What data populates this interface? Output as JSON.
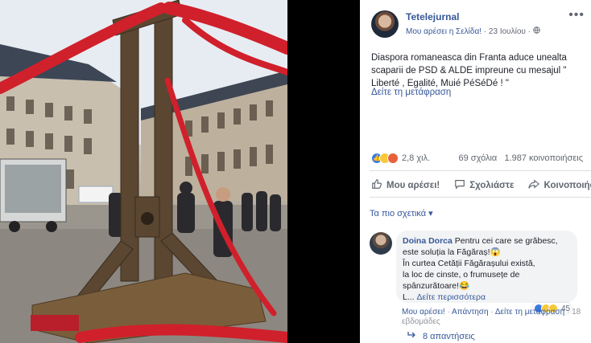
{
  "post": {
    "page_name": "Tetelejurnal",
    "like_page": "Μου αρέσει η Σελίδα!",
    "date": "23 Ιουλίου",
    "text": "Diaspora romaneasca din Franta aduce unealta scaparii de PSD & ALDE impreune cu mesajul \" Liberté , Egalité, Muié PéSéDé ! \"",
    "see_translation": "Δείτε τη μετάφραση",
    "reaction_count": "2,8 χιλ.",
    "comments_count": "69 σχόλια",
    "shares_count": "1.987 κοινοποιήσεις"
  },
  "actions": {
    "like": "Μου αρέσει!",
    "comment": "Σχολιάστε",
    "share": "Κοινοποιήστε"
  },
  "sort_label": "Τα πιο σχετικά ▾",
  "comment": {
    "author": "Doina Dorca",
    "line1": "Pentru cei care se grăbesc,",
    "line2": "este soluția la Făgăraș!😱",
    "line3": "În curtea Cetății Făgărașului există,",
    "line4": "la loc de cinste, o frumusețe de",
    "line5": "spânzurătoare!😂",
    "see_more_prefix": "L...",
    "see_more": "Δείτε περισσότερα",
    "reactions_count": "45",
    "like_action": "Μου αρέσει!",
    "reply_action": "Απάντηση",
    "translation_action": "Δείτε τη μετάφραση",
    "time": "18 εβδομάδες",
    "replies": "8 απαντήσεις"
  },
  "colors": {
    "link": "#365899",
    "meta": "#616770",
    "bubble": "#f2f3f5",
    "like_reaction": "#3b7ce3",
    "haha_reaction": "#f7c938",
    "angry_reaction": "#e8603c",
    "ribbon_red": "#d0202b"
  },
  "icons": {
    "more": "ellipsis-icon",
    "globe": "globe-icon",
    "like": "thumbs-up-icon",
    "comment": "comment-icon",
    "share": "share-arrow-icon",
    "reply": "reply-arrow-icon"
  }
}
